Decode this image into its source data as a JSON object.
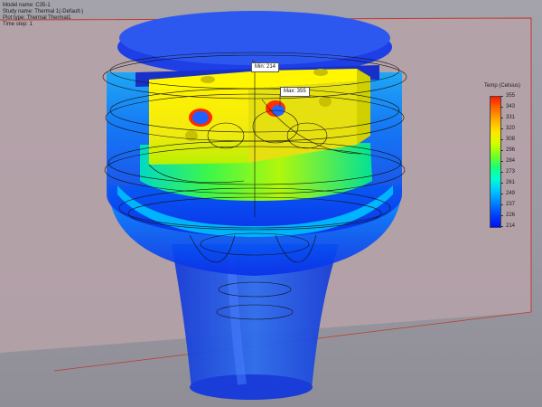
{
  "info": {
    "model_name": "Model name: C35-1",
    "study_name": "Study name: Thermal 1(-Default-)",
    "plot_type": "Plot type: Thermal Thermal1",
    "time_step": "Time step: 1"
  },
  "legend": {
    "title": "Temp (Celsius)",
    "ticks": [
      "355",
      "343",
      "331",
      "320",
      "308",
      "296",
      "284",
      "273",
      "261",
      "249",
      "237",
      "226",
      "214"
    ]
  },
  "probes": {
    "min_label": "Min: 214",
    "max_label": "Max: 355"
  },
  "colors": {
    "background": "#9b9aa4",
    "floor_plane": "#b9a3aa",
    "plane_edge": "#c0392b",
    "hot": "#ff1a00",
    "warm": "#ffe600",
    "mid": "#1aff7a",
    "cool": "#00c8ff",
    "cold": "#0010f0"
  }
}
